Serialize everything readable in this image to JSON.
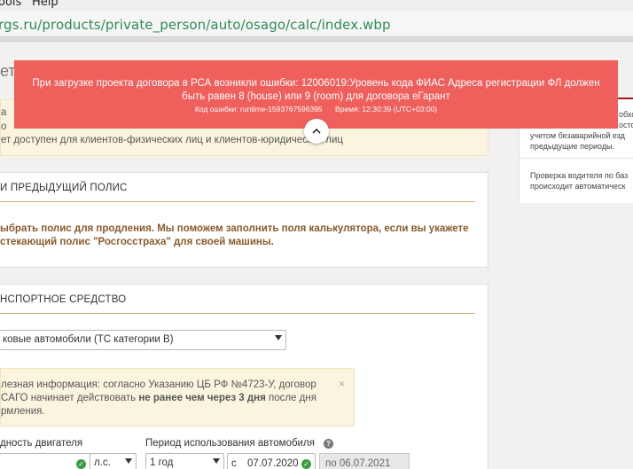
{
  "browser": {
    "menu": [
      "ools",
      "Help"
    ],
    "url": "rgs.ru/products/private_person/auto/osago/calc/index.wbp"
  },
  "page": {
    "title_partial": "ет",
    "notice": {
      "line1": "а",
      "line2": "о",
      "line3": "ет доступен для клиентов-физических лиц и клиентов-юридических лиц"
    },
    "prev_policy": {
      "title": "И ПРЕДЫДУЩИЙ ПОЛИС",
      "text1": "ыбрать полис для продления. Мы поможем заполнить поля калькулятора, если вы укажете",
      "text2": "стекающий полис \"Росгосстраха\" для своей машины."
    },
    "vehicle": {
      "title": "НСПОРТНОЕ СРЕДСТВО",
      "category_value": "ковые автомобили (ТС категории В)",
      "info_line1": "лезная информация: согласно Указанию ЦБ РФ №4723-У, договор",
      "info_line2_pre": "СAГО начинает действовать ",
      "info_line2_bold": "не ранее чем через 3 дня",
      "info_line2_post": " после дня",
      "info_line3": "рмления.",
      "info_close": "×",
      "power_label": "дность двигателя",
      "power_unit": "л.с.",
      "period_label": "Период использования автомобиля",
      "period_value": "1 год",
      "from_prefix": "с",
      "from_date": "07.07.2020",
      "to_text": "по 06.07.2021"
    },
    "sidebar": {
      "line1": "обхс",
      "line2": "осто",
      "line3": "учетом безаварийной езд",
      "line4": "предыдущие периоды.",
      "line5": "Проверка водителя по баз",
      "line6": "происходит автоматическ"
    }
  },
  "error_toast": {
    "message_line1": "При загрузке проекта договора в РСА возникли ошибки: 12006019:Уровень кода ФИАС Адреса регистрации ФЛ должен",
    "message_line2": "быть равен 8 (house) или 9 (room) для договора еГарант",
    "error_code": "Код ошибки: runtime-1593767596395",
    "time": "Время: 12:30:39 (UTC+03:00)",
    "color": "#ef5f5c"
  }
}
